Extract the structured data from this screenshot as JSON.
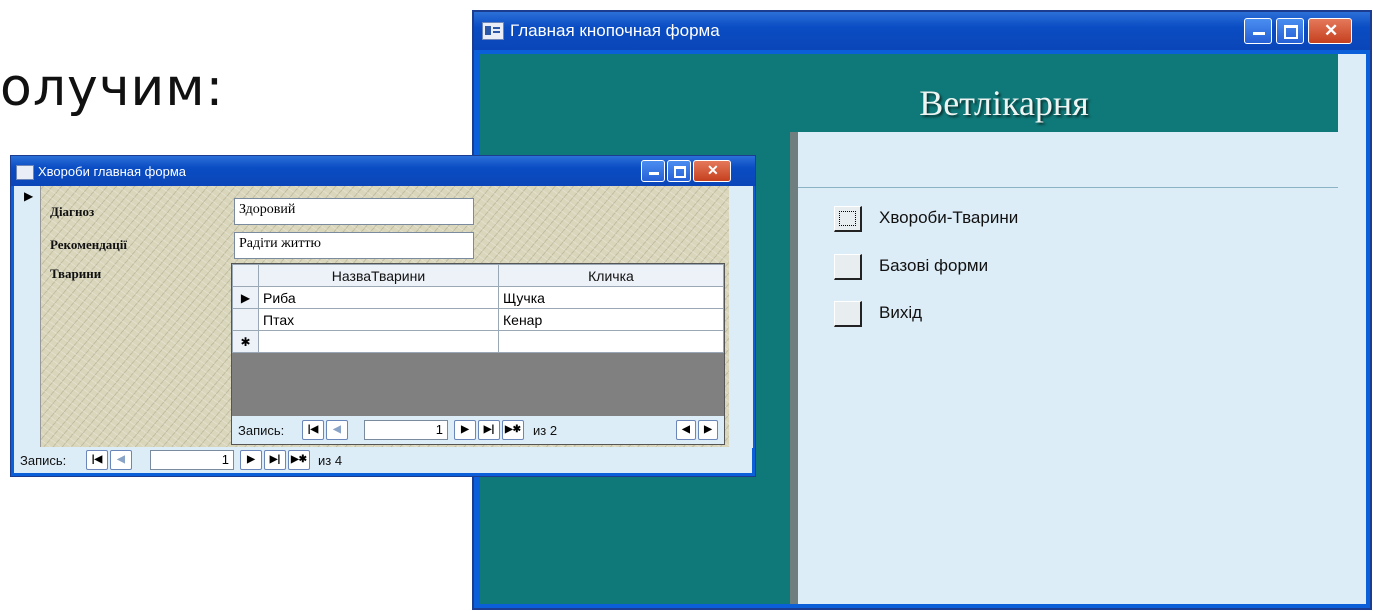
{
  "slide": {
    "text": "олучим:"
  },
  "switchboard": {
    "window_title": "Главная кнопочная форма",
    "app_title": "Ветлікарня",
    "items": [
      {
        "label": "Хвороби-Тварини"
      },
      {
        "label": "Базові форми"
      },
      {
        "label": "Вихід"
      }
    ]
  },
  "diseases_form": {
    "window_title": "Хвороби главная форма",
    "fields": {
      "diagnosis_label": "Діагноз",
      "diagnosis_value": "Здоровий",
      "recommendations_label": "Рекомендації",
      "recommendations_value": "Радіти життю",
      "animals_label": "Тварини"
    },
    "subform": {
      "columns": [
        "НазваТварини",
        "Кличка"
      ],
      "rows": [
        {
          "name": "Риба",
          "nickname": "Щучка"
        },
        {
          "name": "Птах",
          "nickname": "Кенар"
        }
      ],
      "nav": {
        "label": "Запись:",
        "current": "1",
        "total_text": "из 2"
      }
    },
    "nav": {
      "label": "Запись:",
      "current": "1",
      "total_text": "из 4"
    }
  },
  "icons": {
    "first": "first-record-icon",
    "prev": "prev-record-icon",
    "next": "next-record-icon",
    "last": "last-record-icon",
    "new": "new-record-icon"
  }
}
